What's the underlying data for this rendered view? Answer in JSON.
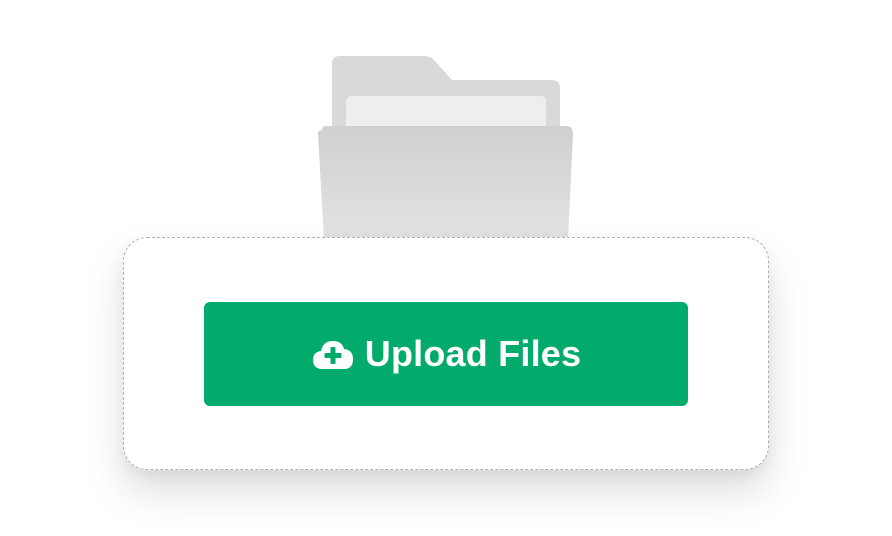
{
  "upload": {
    "button_label": "Upload Files",
    "icon": "cloud-upload-icon"
  },
  "illustration": {
    "icon": "folder-icon"
  },
  "colors": {
    "accent": "#02ab6c",
    "folder": "#d4d5d5",
    "paper": "#ededed",
    "dropzone_border": "#b0b0b0"
  }
}
